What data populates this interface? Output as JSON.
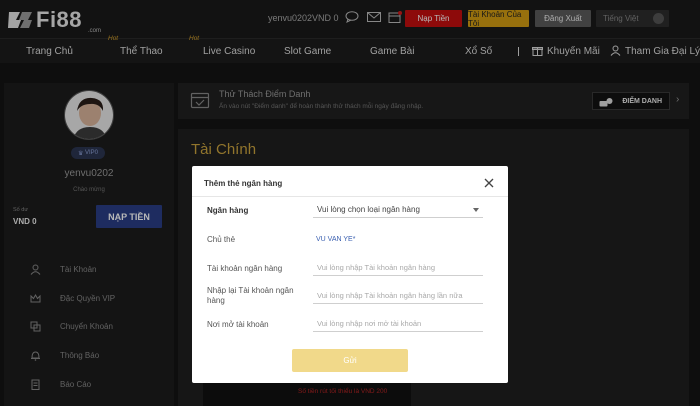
{
  "header": {
    "logo_text": "Fi88",
    "logo_sub": ".com",
    "username": "yenvu0202",
    "balance": "VND 0",
    "icons": [
      "chat-icon",
      "mail-icon",
      "calendar-icon"
    ],
    "deposit_label": "Nạp Tiền",
    "account_label": "Tài Khoản Của Tôi",
    "logout_label": "Đăng Xuất",
    "language_label": "Tiếng Việt",
    "language_code": "VN"
  },
  "nav": {
    "hot_label": "Hot",
    "items": [
      {
        "label": "Trang Chủ"
      },
      {
        "label": "Thể Thao"
      },
      {
        "label": "Live Casino"
      },
      {
        "label": "Slot Game"
      },
      {
        "label": "Game Bài"
      },
      {
        "label": "Xổ Số"
      },
      {
        "label": "Khuyến Mãi"
      },
      {
        "label": "Tham Gia Đại Lý"
      }
    ]
  },
  "sidebar": {
    "vip_label": "VIP0",
    "username": "yenvu0202",
    "greeting": "Chào mừng",
    "balance_caption": "Số dư",
    "balance": "VND 0",
    "deposit_label": "NẠP TIỀN",
    "items": [
      {
        "label": "Tài Khoản",
        "icon": "user-icon"
      },
      {
        "label": "Đặc Quyền VIP",
        "icon": "crown-icon"
      },
      {
        "label": "Chuyển Khoản",
        "icon": "transfer-icon"
      },
      {
        "label": "Thông Báo",
        "icon": "bell-icon"
      },
      {
        "label": "Báo Cáo",
        "icon": "report-icon"
      }
    ]
  },
  "challenge": {
    "title": "Thử Thách Điểm Danh",
    "description": "Ấn vào nút \"Điểm danh\" để hoàn thành thử thách mỗi ngày đăng nhập.",
    "button_label": "ĐIỂM DANH"
  },
  "finance": {
    "title": "Tài Chính",
    "min_note": "Số tiền rút tối thiểu là VND 200"
  },
  "modal": {
    "title": "Thêm thẻ ngân hàng",
    "bank_label": "Ngân hàng",
    "bank_select": "Vui lòng chọn loại ngân hàng",
    "holder_label": "Chủ thẻ",
    "holder_value": "VU VAN YE*",
    "account_label": "Tài khoản ngân hàng",
    "account_placeholder": "Vui lòng nhập Tài khoản ngân hàng",
    "confirm_label": "Nhập lại Tài khoản ngân hàng",
    "confirm_placeholder": "Vui lòng nhập Tài khoản ngân hàng lần nữa",
    "branch_label": "Nơi mở tài khoản",
    "branch_placeholder": "Vui lòng nhập nơi mở tài khoản",
    "submit_label": "Gửi"
  },
  "colors": {
    "accent_gold": "#c9a23e",
    "deposit_red": "#c40e0e",
    "account_gold": "#d29c12",
    "sidebar_blue": "#2a3e86",
    "submit_disabled": "#f1d98a"
  }
}
